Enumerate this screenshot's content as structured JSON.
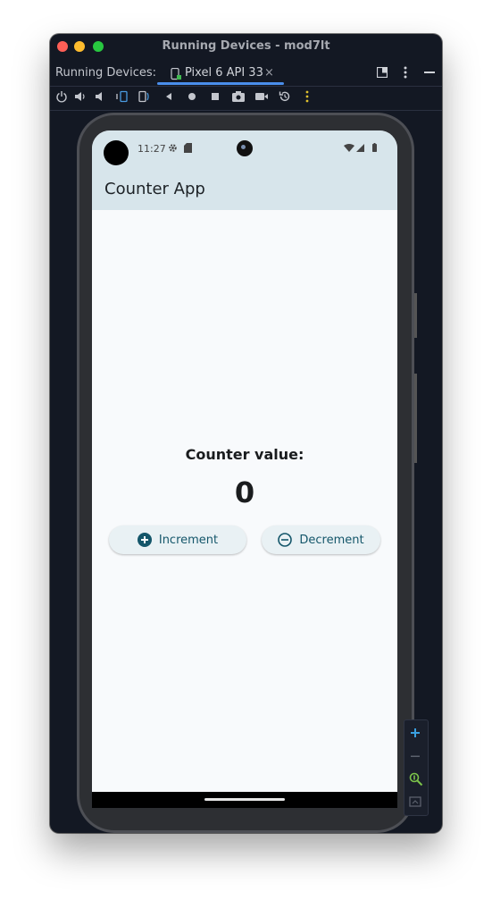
{
  "window": {
    "title": "Running Devices - mod7lt"
  },
  "tabbar": {
    "label": "Running Devices:",
    "device_tab": "Pixel 6 API 33",
    "close_glyph": "×"
  },
  "status_bar": {
    "time": "11:27"
  },
  "app": {
    "title": "Counter App",
    "counter_label": "Counter value:",
    "counter_value": "0",
    "increment_label": "Increment",
    "decrement_label": "Decrement"
  },
  "colors": {
    "ide_background": "#131823",
    "app_bar": "#d7e5eb",
    "button_text": "#14566a",
    "accent_tab": "#4a8eeb"
  },
  "icons": {
    "toolbar": [
      "power-icon",
      "volume-up-icon",
      "volume-down-icon",
      "rotate-left-icon",
      "rotate-right-icon",
      "back-icon",
      "home-icon",
      "overview-icon",
      "screenshot-icon",
      "screen-record-icon",
      "snapshot-icon",
      "more-icon"
    ],
    "buttons": [
      "plus-circle-icon",
      "minus-circle-icon"
    ]
  }
}
